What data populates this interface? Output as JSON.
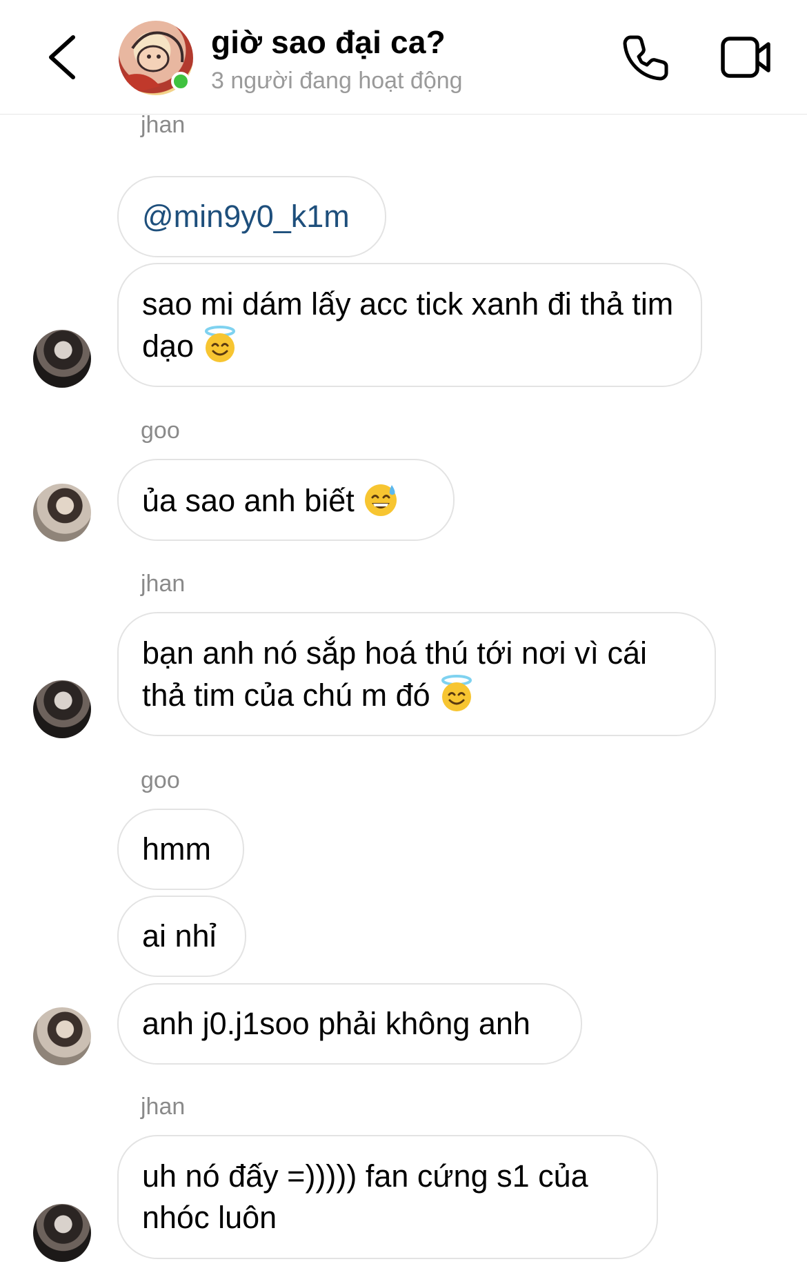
{
  "header": {
    "title": "giờ sao đại ca?",
    "status": "3 người đang hoạt động",
    "back_icon": "chevron-left-icon",
    "call_icon": "phone-icon",
    "video_icon": "video-camera-icon",
    "online_color": "#3fc23f"
  },
  "messages": [
    {
      "sender": "jhan",
      "bubbles": [
        {
          "text": "@min9y0_k1m",
          "type": "mention"
        },
        {
          "text": "sao mi dám lấy acc tick xanh đi thả tim dạo",
          "emoji": "😇"
        }
      ]
    },
    {
      "sender": "goo",
      "bubbles": [
        {
          "text": "ủa sao anh biết",
          "emoji": "😅"
        }
      ]
    },
    {
      "sender": "jhan",
      "bubbles": [
        {
          "text": "bạn anh nó sắp hoá thú tới nơi vì cái thả tim của chú m đó",
          "emoji": "😇"
        }
      ]
    },
    {
      "sender": "goo",
      "bubbles": [
        {
          "text": "hmm"
        },
        {
          "text": "ai nhỉ"
        },
        {
          "text": "anh j0.j1soo phải không anh"
        }
      ]
    },
    {
      "sender": "jhan",
      "bubbles": [
        {
          "text": "uh nó đấy =))))) fan cứng s1 của nhóc luôn"
        }
      ]
    }
  ],
  "colors": {
    "mention": "#1e4f7c",
    "sender_label": "#8a8a8a",
    "bubble_border": "#e3e3e3"
  }
}
